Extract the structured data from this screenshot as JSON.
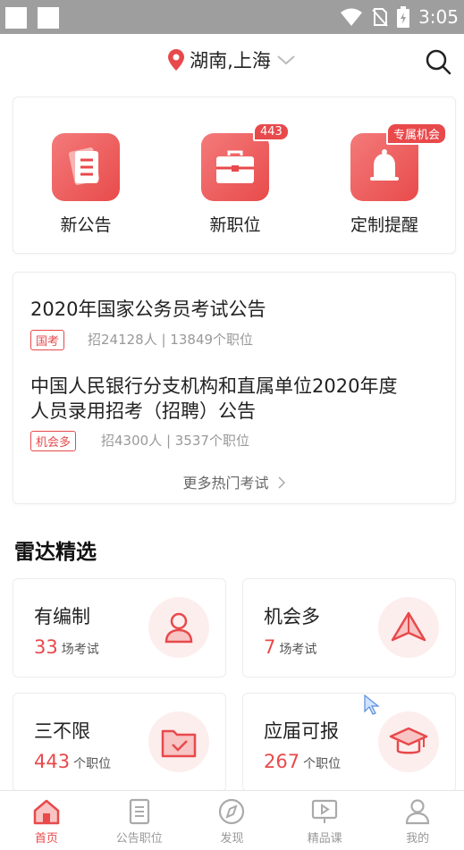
{
  "status_bar": {
    "time": "3:05"
  },
  "header": {
    "location": "湖南,上海"
  },
  "quick_actions": [
    {
      "label": "新公告",
      "icon": "document-icon",
      "badge": ""
    },
    {
      "label": "新职位",
      "icon": "briefcase-icon",
      "badge": "443"
    },
    {
      "label": "定制提醒",
      "icon": "bell-icon",
      "badge": "专属机会"
    }
  ],
  "hot_exams": [
    {
      "title": "2020年国家公务员考试公告",
      "tag": "国考",
      "meta": "招24128人 | 13849个职位"
    },
    {
      "title_line1": "中国人民银行分支机构和直属单位2020年度",
      "title_line2": "人员录用招考（招聘）公告",
      "tag": "机会多",
      "meta": "招4300人 | 3537个职位"
    }
  ],
  "more_link": "更多热门考试",
  "radar": {
    "title": "雷达精选",
    "cards": [
      {
        "title": "有编制",
        "count": "33",
        "unit": "场考试",
        "icon": "person-icon"
      },
      {
        "title": "机会多",
        "count": "7",
        "unit": "场考试",
        "icon": "paper-plane-icon"
      },
      {
        "title": "三不限",
        "count": "443",
        "unit": "个职位",
        "icon": "folder-check-icon"
      },
      {
        "title": "应届可报",
        "count": "267",
        "unit": "个职位",
        "icon": "graduation-cap-icon"
      }
    ]
  },
  "tabs": [
    {
      "label": "首页",
      "icon": "home-icon",
      "active": true
    },
    {
      "label": "公告职位",
      "icon": "list-document-icon",
      "active": false
    },
    {
      "label": "发现",
      "icon": "compass-icon",
      "active": false
    },
    {
      "label": "精品课",
      "icon": "video-lesson-icon",
      "active": false
    },
    {
      "label": "我的",
      "icon": "user-icon",
      "active": false
    }
  ],
  "colors": {
    "accent": "#e8494b",
    "status_bar": "#9e9e9e"
  }
}
